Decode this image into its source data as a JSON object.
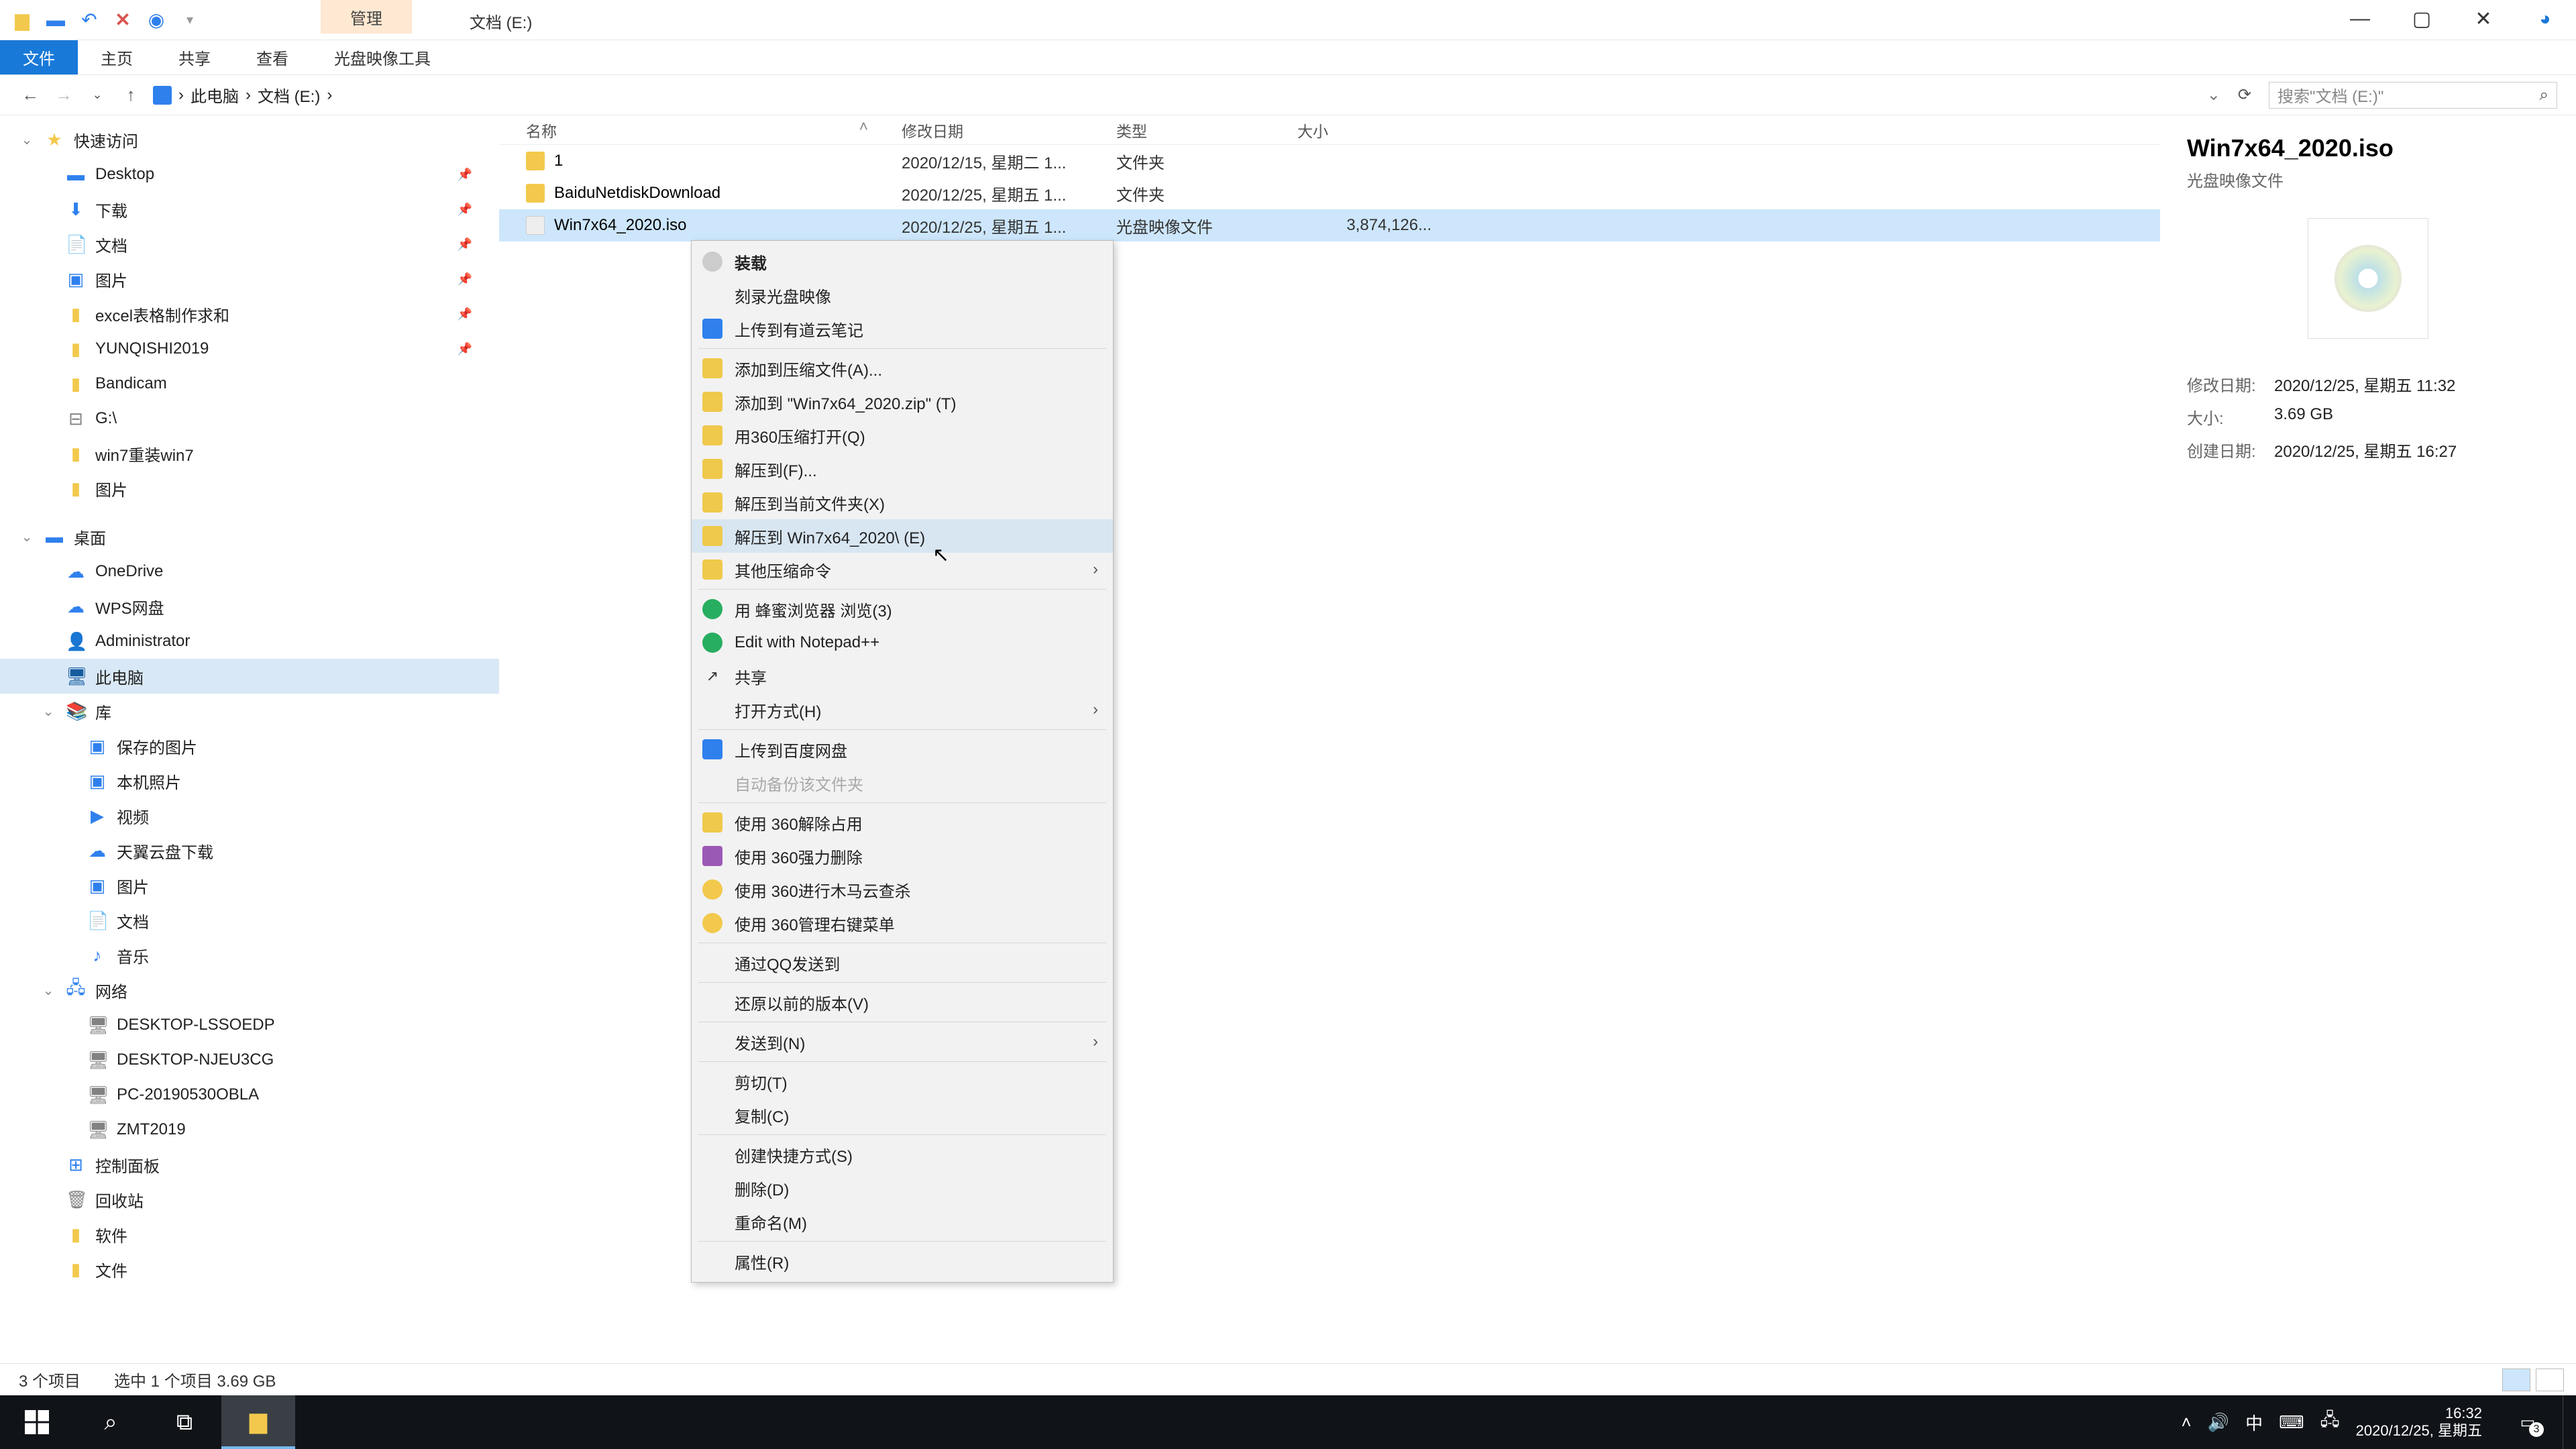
{
  "window": {
    "contextual_tab": "管理",
    "title": "文档 (E:)",
    "file_tab": "文件",
    "tabs": [
      "主页",
      "共享",
      "查看",
      "光盘映像工具"
    ]
  },
  "address": {
    "crumbs": [
      "此电脑",
      "文档 (E:)"
    ],
    "search_placeholder": "搜索\"文档 (E:)\""
  },
  "nav": [
    {
      "label": "快速访问",
      "depth": 0,
      "icon": "★",
      "cls": "star",
      "expand": true
    },
    {
      "label": "Desktop",
      "depth": 1,
      "icon": "▬",
      "cls": "blue",
      "pin": true
    },
    {
      "label": "下载",
      "depth": 1,
      "icon": "⬇",
      "cls": "blue",
      "pin": true
    },
    {
      "label": "文档",
      "depth": 1,
      "icon": "📄",
      "cls": "blue",
      "pin": true
    },
    {
      "label": "图片",
      "depth": 1,
      "icon": "▣",
      "cls": "blue",
      "pin": true
    },
    {
      "label": "excel表格制作求和",
      "depth": 1,
      "icon": "▮",
      "cls": "yellow",
      "pin": true
    },
    {
      "label": "YUNQISHI2019",
      "depth": 1,
      "icon": "▮",
      "cls": "yellow",
      "pin": true
    },
    {
      "label": "Bandicam",
      "depth": 1,
      "icon": "▮",
      "cls": "yellow"
    },
    {
      "label": "G:\\",
      "depth": 1,
      "icon": "⊟",
      "cls": "gray"
    },
    {
      "label": "win7重装win7",
      "depth": 1,
      "icon": "▮",
      "cls": "yellow"
    },
    {
      "label": "图片",
      "depth": 1,
      "icon": "▮",
      "cls": "yellow"
    },
    {
      "label": "桌面",
      "depth": 0,
      "icon": "▬",
      "cls": "blue",
      "expand": true,
      "space": true
    },
    {
      "label": "OneDrive",
      "depth": 1,
      "icon": "☁",
      "cls": "blue"
    },
    {
      "label": "WPS网盘",
      "depth": 1,
      "icon": "☁",
      "cls": "blue"
    },
    {
      "label": "Administrator",
      "depth": 1,
      "icon": "👤",
      "cls": "gray"
    },
    {
      "label": "此电脑",
      "depth": 1,
      "icon": "🖥",
      "cls": "dblue",
      "selected": true
    },
    {
      "label": "库",
      "depth": 1,
      "icon": "📚",
      "cls": "blue",
      "expand": true
    },
    {
      "label": "保存的图片",
      "depth": 2,
      "icon": "▣",
      "cls": "blue"
    },
    {
      "label": "本机照片",
      "depth": 2,
      "icon": "▣",
      "cls": "blue"
    },
    {
      "label": "视频",
      "depth": 2,
      "icon": "▶",
      "cls": "blue"
    },
    {
      "label": "天翼云盘下载",
      "depth": 2,
      "icon": "☁",
      "cls": "blue"
    },
    {
      "label": "图片",
      "depth": 2,
      "icon": "▣",
      "cls": "blue"
    },
    {
      "label": "文档",
      "depth": 2,
      "icon": "📄",
      "cls": "blue"
    },
    {
      "label": "音乐",
      "depth": 2,
      "icon": "♪",
      "cls": "blue"
    },
    {
      "label": "网络",
      "depth": 1,
      "icon": "🖧",
      "cls": "blue",
      "expand": true
    },
    {
      "label": "DESKTOP-LSSOEDP",
      "depth": 2,
      "icon": "🖥",
      "cls": "gray"
    },
    {
      "label": "DESKTOP-NJEU3CG",
      "depth": 2,
      "icon": "🖥",
      "cls": "gray"
    },
    {
      "label": "PC-20190530OBLA",
      "depth": 2,
      "icon": "🖥",
      "cls": "gray"
    },
    {
      "label": "ZMT2019",
      "depth": 2,
      "icon": "🖥",
      "cls": "gray"
    },
    {
      "label": "控制面板",
      "depth": 1,
      "icon": "⊞",
      "cls": "blue"
    },
    {
      "label": "回收站",
      "depth": 1,
      "icon": "🗑",
      "cls": "gray"
    },
    {
      "label": "软件",
      "depth": 1,
      "icon": "▮",
      "cls": "yellow"
    },
    {
      "label": "文件",
      "depth": 1,
      "icon": "▮",
      "cls": "yellow"
    }
  ],
  "columns": {
    "name": "名称",
    "modified": "修改日期",
    "type": "类型",
    "size": "大小"
  },
  "rows": [
    {
      "name": "1",
      "modified": "2020/12/15, 星期二 1...",
      "type": "文件夹",
      "size": "",
      "icon": "folder"
    },
    {
      "name": "BaiduNetdiskDownload",
      "modified": "2020/12/25, 星期五 1...",
      "type": "文件夹",
      "size": "",
      "icon": "folder"
    },
    {
      "name": "Win7x64_2020.iso",
      "modified": "2020/12/25, 星期五 1...",
      "type": "光盘映像文件",
      "size": "3,874,126...",
      "icon": "iso",
      "selected": true
    }
  ],
  "context_menu": [
    {
      "label": "装载",
      "icon": "disc",
      "head": true
    },
    {
      "label": "刻录光盘映像"
    },
    {
      "label": "上传到有道云笔记",
      "icon": "blue"
    },
    {
      "sep": true
    },
    {
      "label": "添加到压缩文件(A)...",
      "icon": "box"
    },
    {
      "label": "添加到 \"Win7x64_2020.zip\" (T)",
      "icon": "box"
    },
    {
      "label": "用360压缩打开(Q)",
      "icon": "box"
    },
    {
      "label": "解压到(F)...",
      "icon": "box"
    },
    {
      "label": "解压到当前文件夹(X)",
      "icon": "box"
    },
    {
      "label": "解压到 Win7x64_2020\\ (E)",
      "icon": "box",
      "hover": true
    },
    {
      "label": "其他压缩命令",
      "icon": "box",
      "sub": true
    },
    {
      "sep": true
    },
    {
      "label": "用 蜂蜜浏览器 浏览(3)",
      "icon": "green"
    },
    {
      "label": "Edit with Notepad++",
      "icon": "green"
    },
    {
      "label": "共享",
      "icon": "share"
    },
    {
      "label": "打开方式(H)",
      "sub": true
    },
    {
      "sep": true
    },
    {
      "label": "上传到百度网盘",
      "icon": "blue"
    },
    {
      "label": "自动备份该文件夹",
      "disabled": true
    },
    {
      "sep": true
    },
    {
      "label": "使用 360解除占用",
      "icon": "box"
    },
    {
      "label": "使用 360强力删除",
      "icon": "purple"
    },
    {
      "label": "使用 360进行木马云查杀",
      "icon": "yellow"
    },
    {
      "label": "使用 360管理右键菜单",
      "icon": "yellow"
    },
    {
      "sep": true
    },
    {
      "label": "通过QQ发送到"
    },
    {
      "sep": true
    },
    {
      "label": "还原以前的版本(V)"
    },
    {
      "sep": true
    },
    {
      "label": "发送到(N)",
      "sub": true
    },
    {
      "sep": true
    },
    {
      "label": "剪切(T)"
    },
    {
      "label": "复制(C)"
    },
    {
      "sep": true
    },
    {
      "label": "创建快捷方式(S)"
    },
    {
      "label": "删除(D)"
    },
    {
      "label": "重命名(M)"
    },
    {
      "sep": true
    },
    {
      "label": "属性(R)"
    }
  ],
  "details": {
    "title": "Win7x64_2020.iso",
    "subtype": "光盘映像文件",
    "meta": [
      {
        "k": "修改日期:",
        "v": "2020/12/25, 星期五 11:32"
      },
      {
        "k": "大小:",
        "v": "3.69 GB"
      },
      {
        "k": "创建日期:",
        "v": "2020/12/25, 星期五 16:27"
      }
    ]
  },
  "status": {
    "items": "3 个项目",
    "selected": "选中 1 个项目  3.69 GB"
  },
  "taskbar": {
    "time": "16:32",
    "date": "2020/12/25, 星期五",
    "ime": "中",
    "notif_count": "3"
  }
}
